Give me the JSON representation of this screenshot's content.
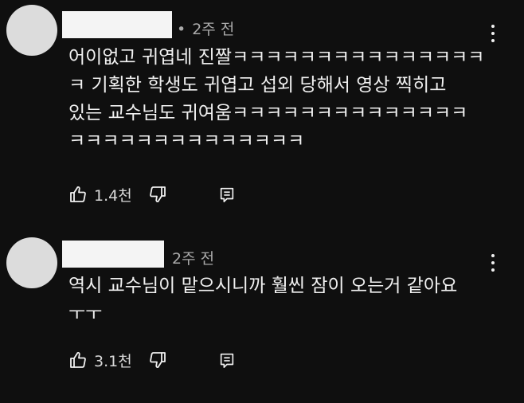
{
  "comments": [
    {
      "time": "2주 전",
      "text": "어이없고 귀엽네 진짤ㅋㅋㅋㅋㅋㅋㅋㅋㅋㅋㅋㅋㅋㅋㅋ\nㅋ 기획한 학생도 귀엽고 섭외 당해서 영상 찍히고\n있는 교수님도 귀여움ㅋㅋㅋㅋㅋㅋㅋㅋㅋㅋㅋㅋㅋㅋ\nㅋㅋㅋㅋㅋㅋㅋㅋㅋㅋㅋㅋㅋㅋ",
      "likes": "1.4천",
      "icons": {
        "like": "thumbs-up-icon",
        "dislike": "thumbs-down-icon",
        "reply": "reply-icon",
        "more": "more-vert-icon"
      }
    },
    {
      "time": "2주 전",
      "text": "역시 교수님이 맡으시니까 훨씬 잠이 오는거 같아요\nㅜㅜ",
      "likes": "3.1천",
      "icons": {
        "like": "thumbs-up-icon",
        "dislike": "thumbs-down-icon",
        "reply": "reply-icon",
        "more": "more-vert-icon"
      }
    }
  ],
  "colors": {
    "background": "#0f0f0f",
    "text": "#f1f1f1",
    "meta": "#aaaaaa",
    "avatar": "#dcdcdc",
    "redaction": "#f4f4f4"
  }
}
